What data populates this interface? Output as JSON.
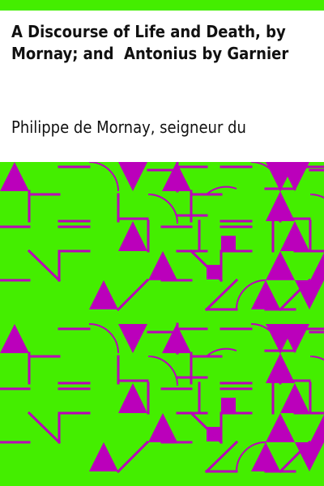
{
  "cover": {
    "title": "A Discourse of Life and Death, by Mornay; and  Antonius by Garnier",
    "author": "Philippe de Mornay, seigneur du"
  },
  "colors": {
    "background": "#ffffff",
    "pattern_ground": "#44ee00",
    "pattern_ink": "#bb00bb",
    "text": "#111111"
  }
}
